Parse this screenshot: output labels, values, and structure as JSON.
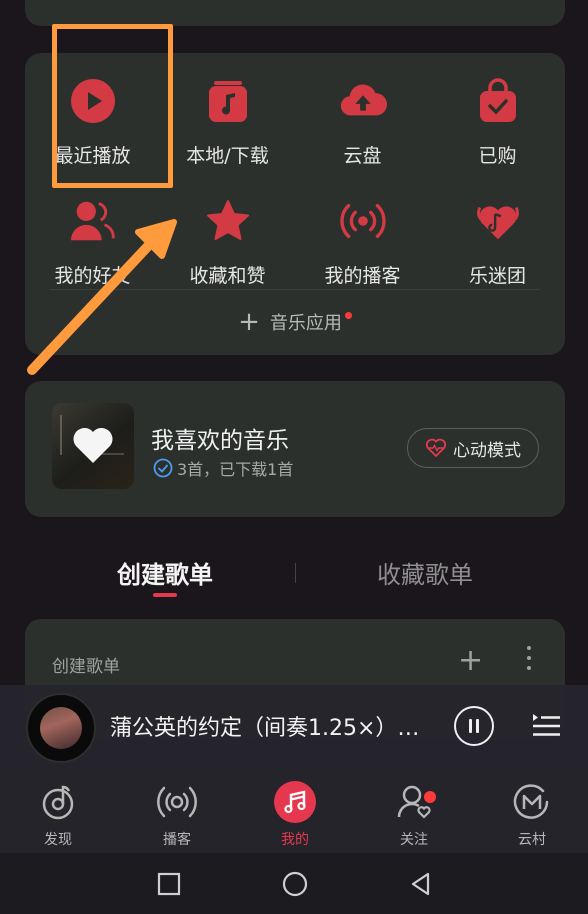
{
  "grid": {
    "items": [
      {
        "label": "最近播放",
        "icon": "play-circle-icon"
      },
      {
        "label": "本地/下载",
        "icon": "music-note-icon"
      },
      {
        "label": "云盘",
        "icon": "cloud-upload-icon"
      },
      {
        "label": "已购",
        "icon": "shopping-bag-check-icon"
      },
      {
        "label": "我的好友",
        "icon": "friends-icon"
      },
      {
        "label": "收藏和赞",
        "icon": "star-icon"
      },
      {
        "label": "我的播客",
        "icon": "broadcast-icon"
      },
      {
        "label": "乐迷团",
        "icon": "fan-group-heart-icon"
      }
    ],
    "add_app_label": "音乐应用"
  },
  "favorites": {
    "title": "我喜欢的音乐",
    "subtitle": "3首，已下载1首",
    "heart_mode_label": "心动模式"
  },
  "tabs": {
    "create": "创建歌单",
    "collect": "收藏歌单"
  },
  "playlist_card": {
    "title": "创建歌单"
  },
  "player": {
    "song": "蒲公英的约定（间奏1.25×）…"
  },
  "tabbar": {
    "items": [
      {
        "label": "发现",
        "icon": "discover-icon"
      },
      {
        "label": "播客",
        "icon": "podcast-icon"
      },
      {
        "label": "我的",
        "icon": "music-notes-icon",
        "active": true
      },
      {
        "label": "关注",
        "icon": "follow-user-icon",
        "badge": true
      },
      {
        "label": "云村",
        "icon": "cloud-village-icon"
      }
    ]
  },
  "colors": {
    "accent": "#e5384e",
    "icon_red": "#d43a43",
    "card_bg": "#2c302d",
    "page_bg": "#1b161c",
    "annotation_orange": "#ff9a3d"
  }
}
